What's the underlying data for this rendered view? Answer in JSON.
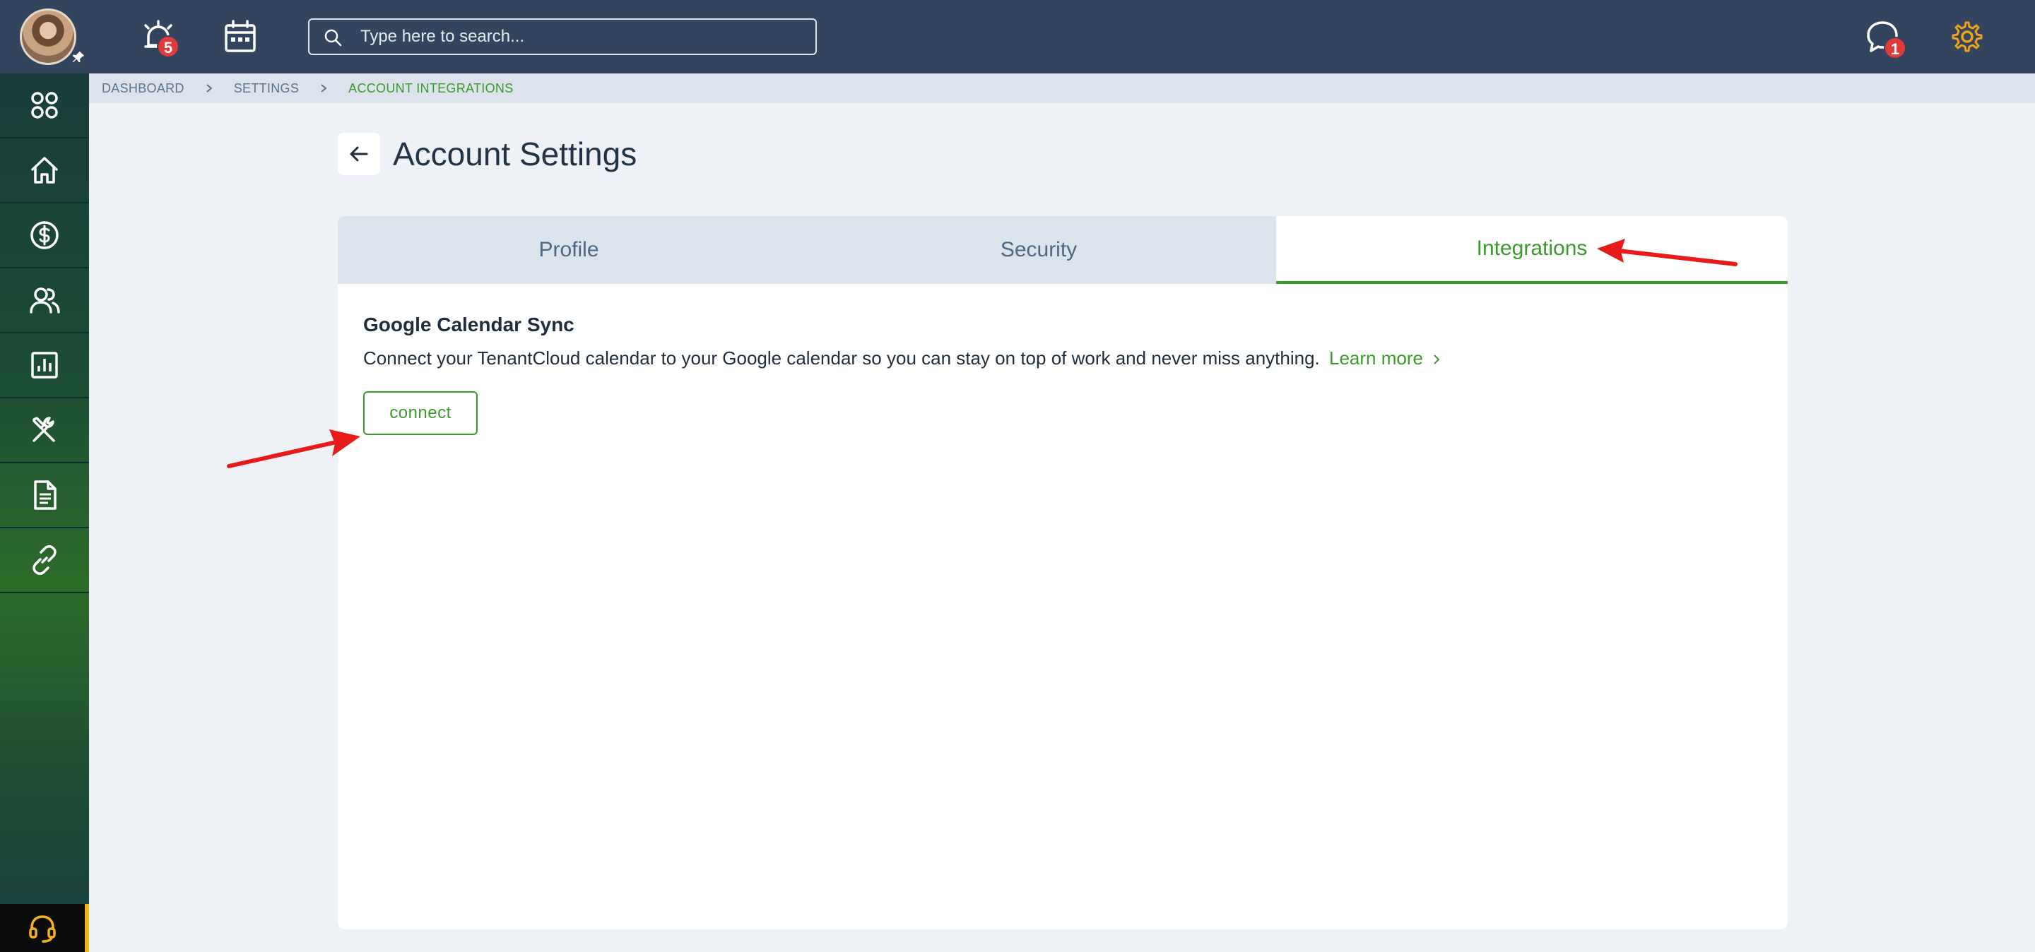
{
  "topbar": {
    "alerts_badge": "5",
    "search_placeholder": "Type here to search...",
    "messages_badge": "1"
  },
  "breadcrumb": {
    "items": [
      "DASHBOARD",
      "SETTINGS",
      "ACCOUNT INTEGRATIONS"
    ]
  },
  "page": {
    "title": "Account Settings"
  },
  "tabs": [
    {
      "label": "Profile"
    },
    {
      "label": "Security"
    },
    {
      "label": "Integrations",
      "active": true
    }
  ],
  "integration": {
    "title": "Google Calendar Sync",
    "description": "Connect your TenantCloud calendar to your Google calendar so you can stay on top of work and never miss anything.",
    "learn_more": "Learn more",
    "connect_label": "connect"
  },
  "sidebar": {
    "items": [
      "apps-icon",
      "home-icon",
      "dollar-icon",
      "users-icon",
      "reports-icon",
      "tools-icon",
      "document-icon",
      "link-icon"
    ]
  },
  "colors": {
    "topbar": "#33455e",
    "accent_green": "#3a9a2b",
    "badge_red": "#e13a3a",
    "gear_orange": "#f0a21a",
    "annotation_red": "#e81b1b"
  }
}
